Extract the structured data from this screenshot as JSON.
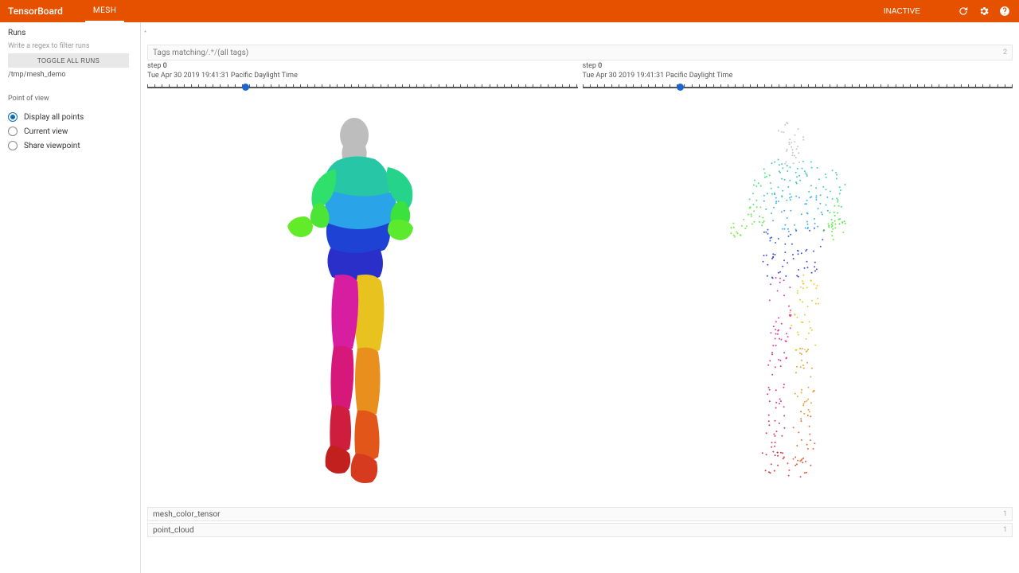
{
  "header": {
    "brand": "TensorBoard",
    "active_tab": "MESH",
    "status_label": "INACTIVE",
    "icons": {
      "refresh": "refresh-icon",
      "settings": "gear-icon",
      "help": "help-icon",
      "chevron": "chevron-down-icon"
    }
  },
  "sidebar": {
    "runs_title": "Runs",
    "filter_hint": "Write a regex to filter runs",
    "toggle_label": "TOGGLE ALL RUNS",
    "run_path": "/tmp/mesh_demo",
    "pov": {
      "title": "Point of view",
      "options": [
        {
          "label": "Display all points",
          "selected": true
        },
        {
          "label": "Current view",
          "selected": false
        },
        {
          "label": "Share viewpoint",
          "selected": false
        }
      ]
    }
  },
  "handle": "•",
  "tags_bar": {
    "prefix": "Tags matching ",
    "pattern": "/.*/",
    "suffix": "(all tags)",
    "count": "2"
  },
  "panels": [
    {
      "step_label": "step",
      "step_value": "0",
      "timestamp": "Tue Apr 30 2019 19:41:31 Pacific Daylight Time",
      "thumb_pos_pct": 22
    },
    {
      "step_label": "step",
      "step_value": "0",
      "timestamp": "Tue Apr 30 2019 19:41:31 Pacific Daylight Time",
      "thumb_pos_pct": 22
    }
  ],
  "tag_rows": [
    {
      "name": "mesh_color_tensor",
      "count": "1"
    },
    {
      "name": "point_cloud",
      "count": "1"
    }
  ]
}
